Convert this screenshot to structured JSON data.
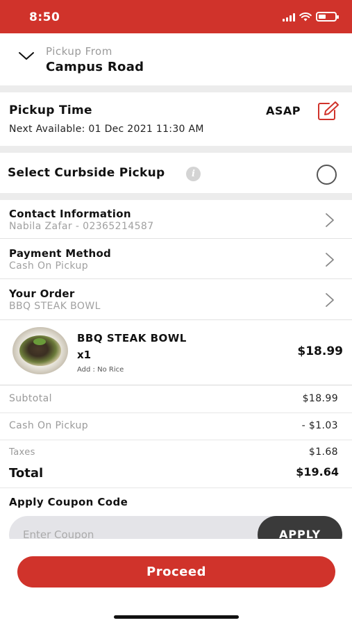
{
  "status_bar": {
    "time": "8:50",
    "background_color": "#d0332b",
    "icons": [
      "signal-icon",
      "wifi-icon",
      "battery-icon"
    ]
  },
  "pickup_from": {
    "label": "Pickup From",
    "value": "Campus Road",
    "icon": "chevron-down-icon"
  },
  "pickup_time": {
    "title": "Pickup Time",
    "next_available": "Next Available: 01 Dec 2021 11:30 AM",
    "mode": "ASAP",
    "edit_icon": "edit-icon",
    "accent_color": "#d0332b"
  },
  "curbside": {
    "label": "Select Curbside Pickup",
    "info_icon": "info-icon",
    "selected": false
  },
  "rows": [
    {
      "title": "Contact Information",
      "subtitle": "Nabila Zafar - 02365214587"
    },
    {
      "title": "Payment Method",
      "subtitle": "Cash On Pickup"
    },
    {
      "title": "Your Order",
      "subtitle": "BBQ STEAK BOWL"
    }
  ],
  "order_item": {
    "name": "BBQ STEAK BOWL",
    "quantity": "x1",
    "addon": "Add : No Rice",
    "price": "$18.99"
  },
  "summary": {
    "subtotal_label": "Subtotal",
    "subtotal_value": "$18.99",
    "discount_label": "Cash On Pickup",
    "discount_value": "- $1.03",
    "taxes_label": "Taxes",
    "taxes_value": "$1.68",
    "total_label": "Total",
    "total_value": "$19.64"
  },
  "coupon": {
    "title": "Apply Coupon Code",
    "placeholder": "Enter Coupon",
    "apply_label": "APPLY"
  },
  "footer": {
    "proceed_label": "Proceed",
    "button_color": "#d0332b"
  }
}
